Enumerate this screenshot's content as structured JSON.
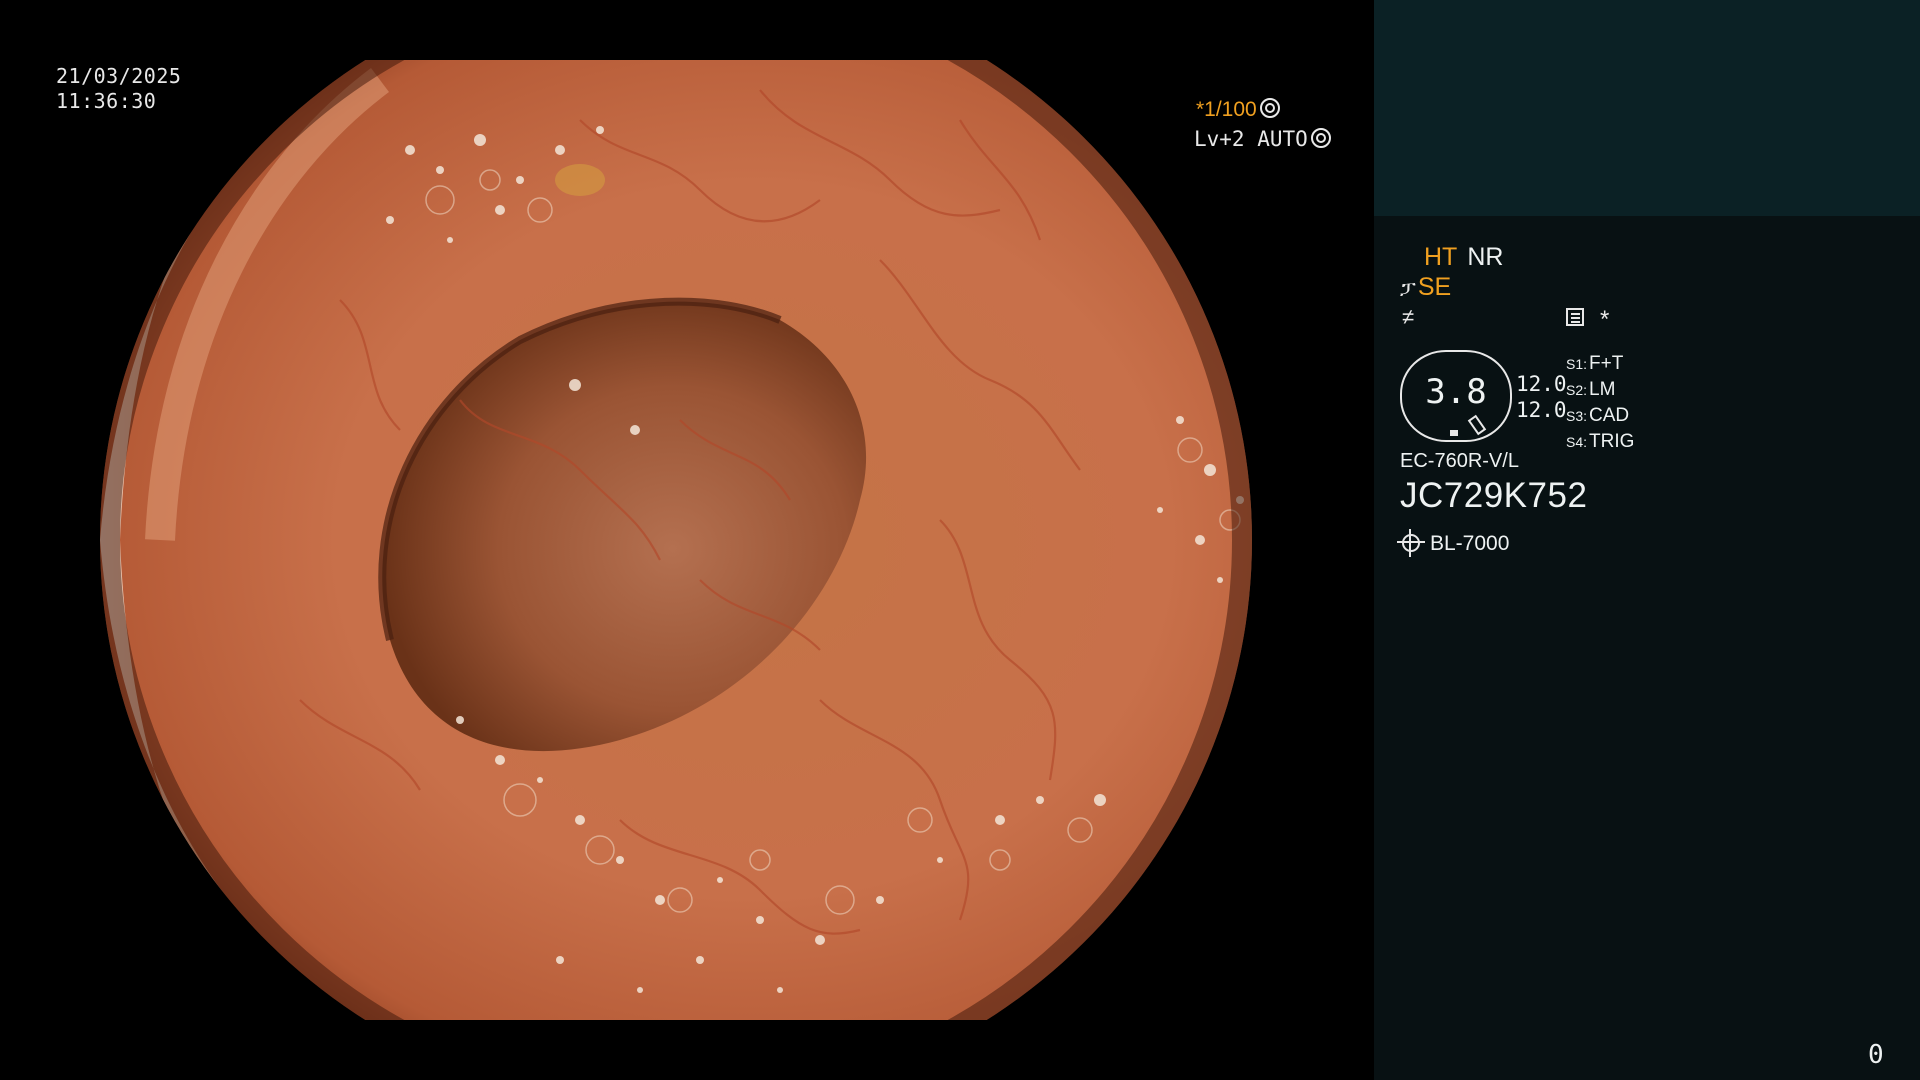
{
  "overlay": {
    "date": "21/03/2025",
    "time": "11:36:30",
    "shutter": "*1/100",
    "level": "Lv+2 AUTO"
  },
  "panel": {
    "ht": "HT",
    "nr": "NR",
    "se": "SE",
    "gauge_value": "3.8",
    "values": [
      "12.0",
      "12.0"
    ],
    "switches": [
      {
        "key": "S1:",
        "value": "F+T"
      },
      {
        "key": "S2:",
        "value": "LM"
      },
      {
        "key": "S3:",
        "value": "CAD"
      },
      {
        "key": "S4:",
        "value": "TRIG"
      }
    ],
    "model": "EC-760R-V/L",
    "serial": "JC729K752",
    "light_source": "BL-7000",
    "counter": "0"
  },
  "colors": {
    "accent_orange": "#f0a020",
    "panel_top": "#0b2125",
    "panel_bottom": "#081113"
  },
  "icons": [
    "shutter-icon",
    "auto-icon",
    "scope-icon",
    "menu-icon",
    "light-icon"
  ]
}
